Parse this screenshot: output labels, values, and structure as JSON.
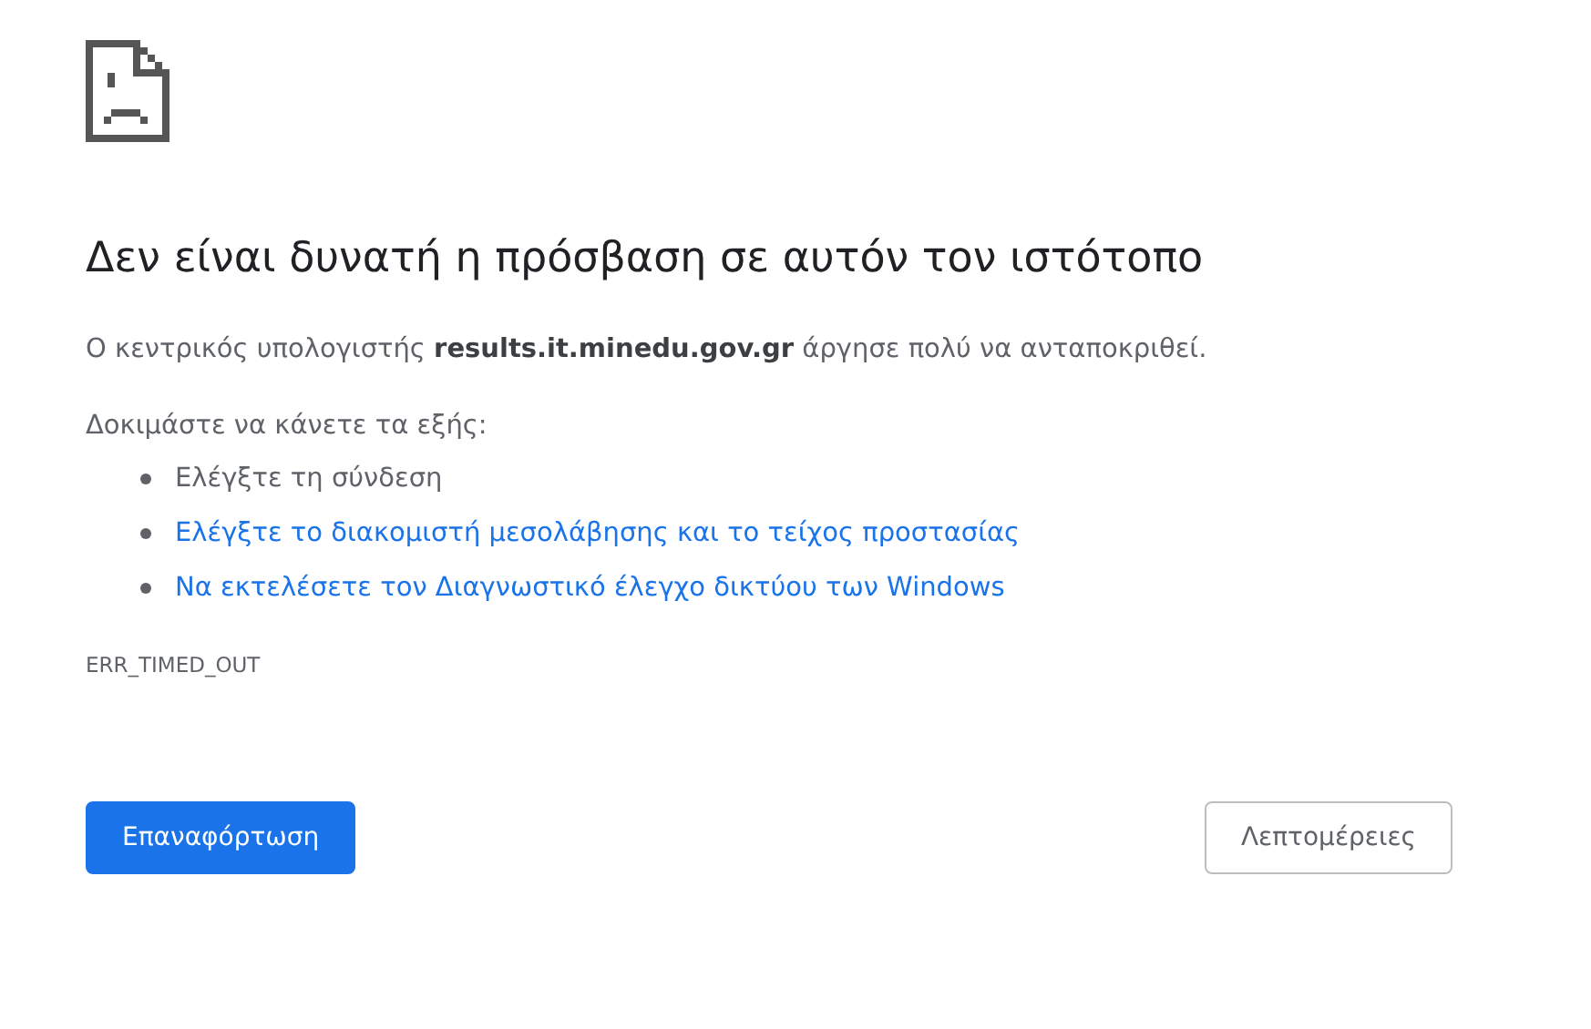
{
  "heading": "Δεν είναι δυνατή η πρόσβαση σε αυτόν τον ιστότοπο",
  "summary": "Ο κεντρικός υπολογιστής **results.it.minedu.gov.gr** άργησε πολύ να ανταποκριθεί.",
  "suggestions_intro": "Δοκιμάστε να κάνετε τα εξής:",
  "suggestions": [
    {
      "kind": "text",
      "label": "Ελέγξτε τη σύνδεση"
    },
    {
      "kind": "link",
      "label": "Ελέγξτε το διακομιστή μεσολάβησης και το τείχος προστασίας"
    },
    {
      "kind": "link",
      "label": "Να εκτελέσετε τον Διαγνωστικό έλεγχο δικτύου των Windows"
    }
  ],
  "error_code": "ERR_TIMED_OUT",
  "buttons": [
    {
      "kind": "primary",
      "label": "Επαναφόρτωση"
    },
    {
      "kind": "secondary",
      "label": "Λεπτομέρειες"
    }
  ]
}
